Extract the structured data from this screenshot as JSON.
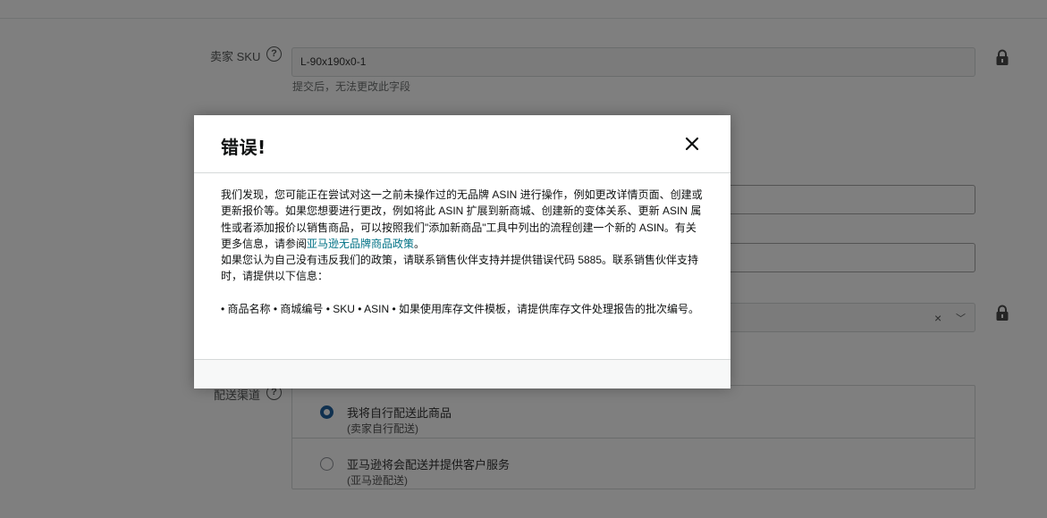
{
  "form": {
    "seller_sku": {
      "label": "卖家 SKU",
      "value": "L-90x190x0-1",
      "hint": "提交后，无法更改此字段"
    },
    "fulfillment": {
      "label": "配送渠道",
      "options": [
        {
          "title": "我将自行配送此商品",
          "subtitle": "(卖家自行配送)",
          "checked": true
        },
        {
          "title": "亚马逊将会配送并提供客户服务",
          "subtitle": "(亚马逊配送)",
          "checked": false
        }
      ]
    },
    "select_clear_glyph": "×",
    "select_chevron_glyph": "﹀"
  },
  "modal": {
    "title": "错误!",
    "close_icon": "close-icon",
    "paragraph1_text": "我们发现，您可能正在尝试对这一之前未操作过的无品牌 ASIN 进行操作，例如更改详情页面、创建或更新报价等。如果您想要进行更改，例如将此 ASIN 扩展到新商城、创建新的变体关系、更新 ASIN 属性或者添加报价以销售商品，可以按照我们\"添加新商品\"工具中列出的流程创建一个新的 ASIN。有关更多信息，请参阅",
    "paragraph1_link": "亚马逊无品牌商品政策",
    "paragraph1_end": "。",
    "paragraph2": "如果您认为自己没有违反我们的政策，请联系销售伙伴支持并提供错误代码 5885。联系销售伙伴支持时，请提供以下信息：",
    "paragraph3": "• 商品名称 • 商城编号 • SKU • ASIN • 如果使用库存文件模板，请提供库存文件处理报告的批次编号。"
  },
  "colors": {
    "overlay": "rgba(0,0,0,0.5)",
    "link": "#007185",
    "radio_checked": "#2162a1"
  }
}
